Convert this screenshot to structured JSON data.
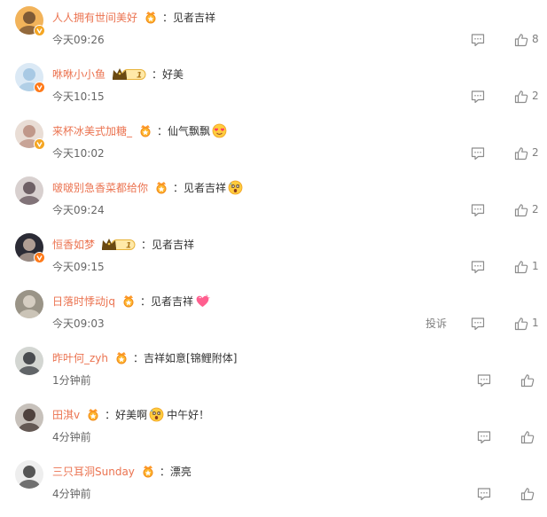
{
  "comments": [
    {
      "user": "人人拥有世间美好",
      "badge": "medal",
      "text": "：见者吉祥",
      "emojis": [],
      "time": "今天09:26",
      "verified": true,
      "verified_color": "#f5a623",
      "likes": "8",
      "report": "",
      "avatar_colors": [
        "#f2b35a",
        "#6b4a2f"
      ]
    },
    {
      "user": "咻咻小小鱼",
      "badge": "vip1",
      "text": "：好美",
      "emojis": [],
      "time": "今天10:15",
      "verified": true,
      "verified_color": "#ff7a1a",
      "likes": "2",
      "report": "",
      "avatar_colors": [
        "#dbe9f5",
        "#9fc3e0"
      ]
    },
    {
      "user": "来杯冰美式加糖_",
      "badge": "medal",
      "text": "：仙气飘飘",
      "emojis": [
        "heart-eyes-emoji"
      ],
      "time": "今天10:02",
      "verified": true,
      "verified_color": "#f5a623",
      "likes": "2",
      "report": "",
      "avatar_colors": [
        "#e9ddd5",
        "#b98c7c"
      ]
    },
    {
      "user": "啵啵别急香菜都给你",
      "badge": "medal",
      "text": "：见者吉祥",
      "emojis": [
        "shocked-emoji"
      ],
      "time": "今天09:24",
      "verified": false,
      "verified_color": "",
      "likes": "2",
      "report": "",
      "avatar_colors": [
        "#d8d0cf",
        "#5c4c52"
      ]
    },
    {
      "user": "恒香如梦",
      "badge": "vip1",
      "text": "：见者吉祥",
      "emojis": [],
      "time": "今天09:15",
      "verified": true,
      "verified_color": "#ff7a1a",
      "likes": "1",
      "report": "",
      "avatar_colors": [
        "#2b2b35",
        "#c9b3a5"
      ]
    },
    {
      "user": "日落时悸动jq",
      "badge": "medal",
      "text": "：见者吉祥",
      "emojis": [
        "pink-heart-emoji"
      ],
      "time": "今天09:03",
      "verified": false,
      "verified_color": "",
      "likes": "1",
      "report": "投诉",
      "avatar_colors": [
        "#9a9487",
        "#e0d8cc"
      ]
    },
    {
      "user": "昨叶何_zyh",
      "badge": "medal",
      "text": "：吉祥如意[锦鲤附体]",
      "emojis": [],
      "time": "1分钟前",
      "verified": false,
      "verified_color": "",
      "likes": "",
      "report": "",
      "avatar_colors": [
        "#d3d6d2",
        "#30343a"
      ]
    },
    {
      "user": "田淇v",
      "badge": "medal",
      "text": "：好美啊",
      "emojis": [
        "shocked-emoji"
      ],
      "text2": "中午好！",
      "time": "4分钟前",
      "verified": false,
      "verified_color": "",
      "likes": "",
      "report": "",
      "avatar_colors": [
        "#c7c1bb",
        "#3a2c28"
      ]
    },
    {
      "user": "三只耳洞Sunday",
      "badge": "medal",
      "text": "：漂亮",
      "emojis": [],
      "time": "4分钟前",
      "verified": false,
      "verified_color": "",
      "likes": "",
      "report": "",
      "avatar_colors": [
        "#eeeeee",
        "#3b3b3b"
      ]
    }
  ],
  "colors": {
    "username": "#eb7350",
    "time": "#666666",
    "icon": "#8c8c8c"
  }
}
